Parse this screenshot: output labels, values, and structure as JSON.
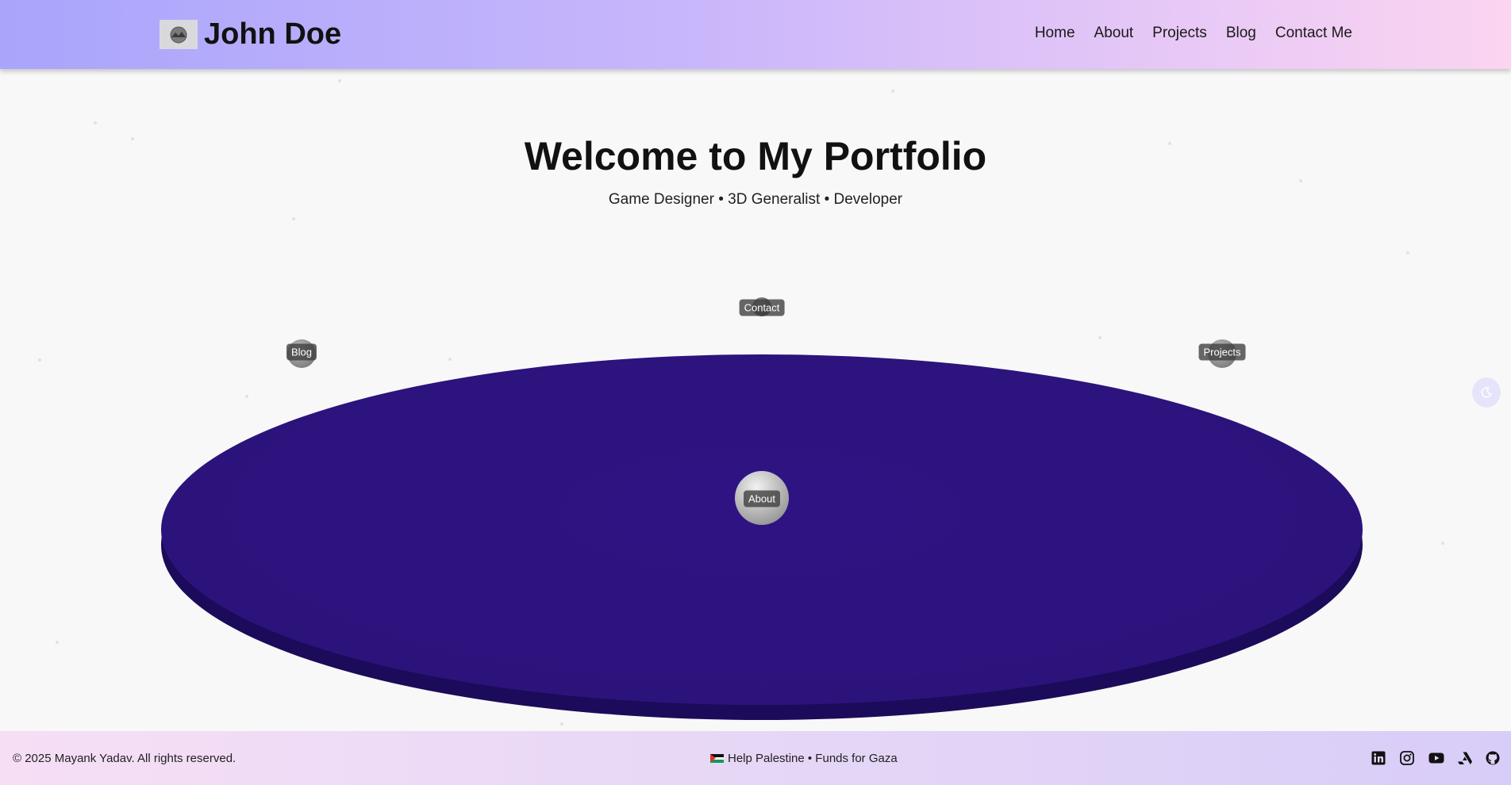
{
  "header": {
    "brand_name": "John Doe",
    "nav": [
      "Home",
      "About",
      "Projects",
      "Blog",
      "Contact Me"
    ],
    "gradient": [
      "#a9a5fb",
      "#fbd4f0"
    ]
  },
  "hero": {
    "title": "Welcome to My Portfolio",
    "subtitle": "Game Designer • 3D Generalist • Developer"
  },
  "scene": {
    "disc_color": "#2c137d",
    "orbs": {
      "contact": "Contact",
      "blog": "Blog",
      "projects": "Projects",
      "about": "About"
    }
  },
  "theme_toggle": {
    "icon": "moon-icon"
  },
  "footer": {
    "copyright": "© 2025 Mayank Yadav. All rights reserved.",
    "help_text": "Help Palestine • Funds for Gaza",
    "socials": [
      "linkedin-icon",
      "instagram-icon",
      "youtube-icon",
      "artstation-icon",
      "github-icon"
    ]
  }
}
